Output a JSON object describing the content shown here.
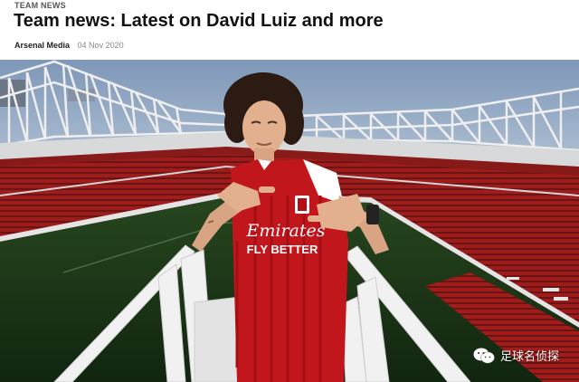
{
  "article": {
    "kicker": "TEAM NEWS",
    "title": "Team news: Latest on David Luiz and more",
    "author": "Arsenal Media",
    "date": "04 Nov 2020"
  },
  "hero_image": {
    "shirt_sponsor_line1": "Emirates",
    "shirt_sponsor_line2": "FLY BETTER"
  },
  "watermark": {
    "icon": "wechat-icon",
    "text": "足球名侦探"
  },
  "colors": {
    "seat_red": "#b3201f",
    "pitch_green": "#1d3b1a",
    "sky": "#93a9c4",
    "shirt_red": "#c1161b"
  }
}
